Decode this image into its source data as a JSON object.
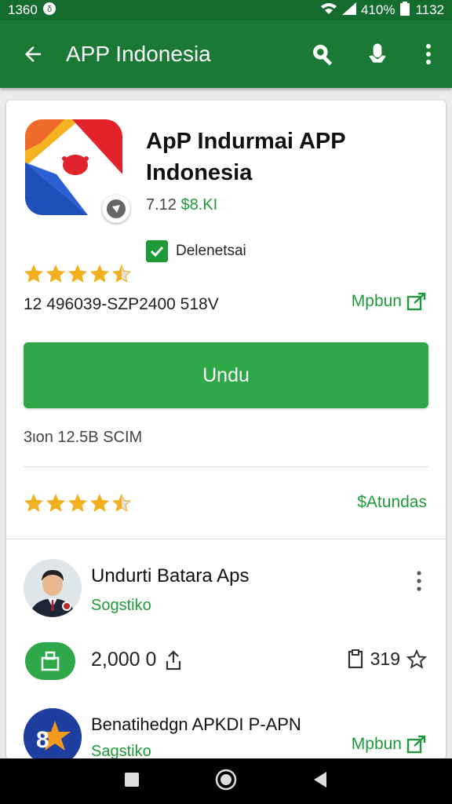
{
  "status_bar": {
    "time_left": "1360",
    "battery": "410%",
    "time_right": "1132"
  },
  "appbar": {
    "title": "APP Indonesia"
  },
  "app": {
    "title": "ApP Indurmai APP Indonesia",
    "version": "7.12",
    "size": "$8.KI",
    "developer_label": "Delenetsai",
    "rating_stars": 4.5,
    "code_line": "12 496039-SZP2400 518V",
    "link_label": "Mpbun",
    "install_label": "Undu",
    "size_line": "3ιon 12.5B SCIM",
    "rating2_stars": 4.5,
    "rating2_link": "$Atundas"
  },
  "related": [
    {
      "title": "Undurti Batara Aps",
      "subtitle": "Sogstiko",
      "count_left": "2,000 0",
      "count_right": "319"
    },
    {
      "title": "Benatihedgn APKDI P-APN",
      "subtitle": "Sagstiko",
      "link": "Mpbun"
    }
  ],
  "colors": {
    "primary": "#1a7a35",
    "accent": "#2fa84a",
    "star": "#f2b01e"
  }
}
